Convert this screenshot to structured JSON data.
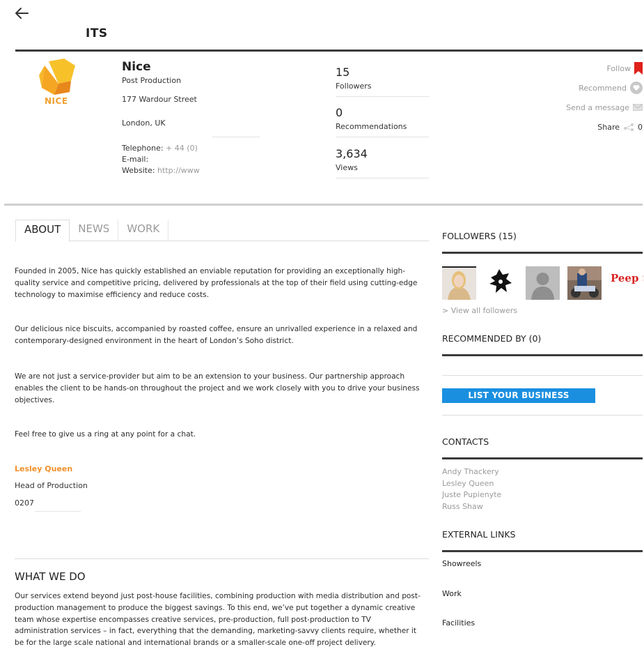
{
  "header": {
    "site_title": "ITS"
  },
  "profile": {
    "name": "Nice",
    "type": "Post Production",
    "logo_text": "NICE",
    "address_street": "177 Wardour Street",
    "address_city": "London, UK",
    "telephone_label": "Telephone:",
    "telephone_value": "+ 44 (0)",
    "email_label": "E-mail:",
    "website_label": "Website:",
    "website_value": "http://www"
  },
  "stats": [
    {
      "value": "15",
      "label": "Followers"
    },
    {
      "value": "0",
      "label": "Recommendations"
    },
    {
      "value": "3,634",
      "label": "Views"
    }
  ],
  "actions": {
    "follow": "Follow",
    "recommend": "Recommend",
    "message": "Send a message",
    "share": "Share",
    "share_count": "0"
  },
  "tabs": [
    {
      "label": "ABOUT"
    },
    {
      "label": "NEWS"
    },
    {
      "label": "WORK"
    }
  ],
  "about": {
    "p1": "Founded in 2005, Nice has quickly established an enviable reputation for providing an exceptionally high-quality service and competitive pricing, delivered by professionals at the top of their field using cutting-edge technology to maximise efficiency and reduce costs.",
    "p2": "Our delicious nice biscuits, accompanied by roasted coffee, ensure an unrivalled experience in a relaxed and contemporary-designed environment in the heart of London’s Soho district.",
    "p3": "We are not just a service-provider but aim to be an extension to your business. Our partnership approach enables the client to be hands-on throughout the project and we work closely with you to drive your business objectives.",
    "p4": "Feel free to give us a ring at any point for a chat.",
    "contact_name": "Lesley Queen",
    "contact_role": "Head of Production",
    "contact_phone": "0207"
  },
  "what_we_do": {
    "title": "WHAT WE DO",
    "text": "Our services extend beyond just post-house facilities, combining production with media distribution and post-production management to produce the biggest savings. To this end, we’ve put together a dynamic creative team whose expertise encompasses creative services, pre-production, full post-production to TV administration services – in fact, everything that the demanding, marketing-savvy clients require, whether it be for the large scale national and international brands or a smaller-scale one-off project delivery."
  },
  "sidebar": {
    "followers_title": "FOLLOWERS (15)",
    "view_all": "> View all followers",
    "recommended_title": "RECOMMENDED BY (0)",
    "list_business": "LIST YOUR BUSINESS",
    "contacts_title": "CONTACTS",
    "contacts": [
      "Andy Thackery",
      "Lesley Queen",
      "Juste Pupienyte",
      "Russ Shaw"
    ],
    "external_title": "EXTERNAL LINKS",
    "external_links": [
      "Showreels",
      "Work",
      "Facilities"
    ],
    "peep_show_text": "Peep Show"
  },
  "colors": {
    "accent_orange": "#f0902a",
    "button_blue": "#1a8fe0",
    "follow_red": "#e0201b"
  },
  "icons": {
    "back": "back-arrow-icon",
    "follow": "bookmark-icon",
    "recommend": "heart-icon",
    "message": "envelope-icon",
    "share": "share-icon"
  }
}
